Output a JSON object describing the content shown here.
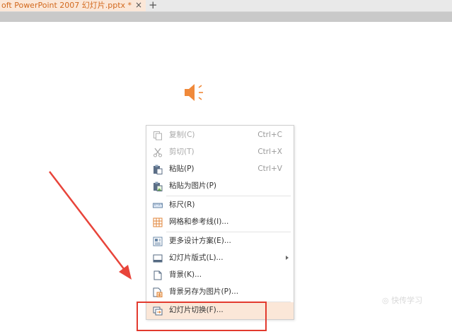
{
  "tab": {
    "title": "oft PowerPoint 2007 幻灯片.pptx *",
    "close": "×",
    "add": "+"
  },
  "colors": {
    "accent": "#d2691e",
    "highlight": "#e23a2e",
    "hover_bg": "#fbe7d8"
  },
  "speaker_icon": "audio-speaker-icon",
  "context_menu": {
    "items": [
      {
        "label": "复制(C)",
        "shortcut": "Ctrl+C",
        "icon": "copy-icon",
        "disabled": true
      },
      {
        "label": "剪切(T)",
        "shortcut": "Ctrl+X",
        "icon": "scissors-icon",
        "disabled": true
      },
      {
        "label": "粘贴(P)",
        "shortcut": "Ctrl+V",
        "icon": "paste-icon"
      },
      {
        "label": "粘贴为图片(P)",
        "shortcut": "",
        "icon": "paste-image-icon"
      },
      {
        "label": "标尺(R)",
        "shortcut": "",
        "icon": "ruler-icon"
      },
      {
        "label": "网格和参考线(I)...",
        "shortcut": "",
        "icon": "grid-icon"
      },
      {
        "label": "更多设计方案(E)...",
        "shortcut": "",
        "icon": "design-icon"
      },
      {
        "label": "幻灯片版式(L)...",
        "shortcut": "",
        "icon": "layout-icon",
        "submenu": true
      },
      {
        "label": "背景(K)...",
        "shortcut": "",
        "icon": "background-icon"
      },
      {
        "label": "背景另存为图片(P)...",
        "shortcut": "",
        "icon": "save-background-icon"
      },
      {
        "label": "幻灯片切换(F)...",
        "shortcut": "",
        "icon": "transition-icon",
        "highlighted": true
      }
    ]
  },
  "watermark": {
    "line1": "◎ 快传学习",
    "line2": ""
  }
}
